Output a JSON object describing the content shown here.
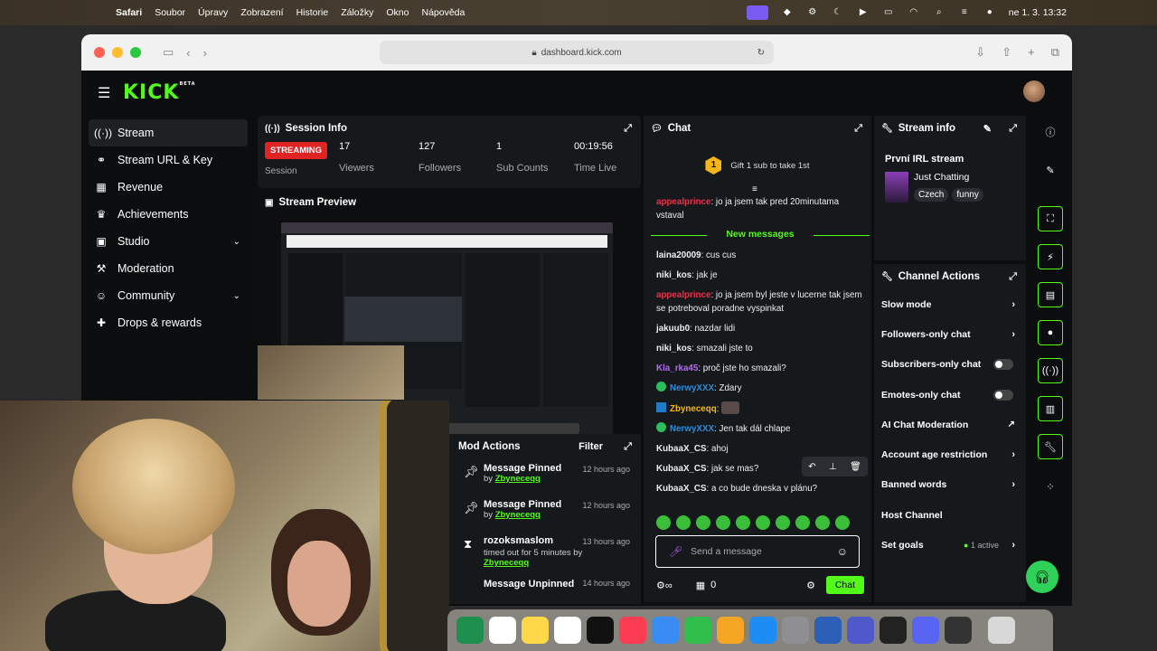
{
  "menubar": {
    "app": "Safari",
    "items": [
      "Soubor",
      "Úpravy",
      "Zobrazení",
      "Historie",
      "Záložky",
      "Okno",
      "Nápověda"
    ],
    "clock": "ne 1. 3.  13:32"
  },
  "browser": {
    "url": "dashboard.kick.com"
  },
  "brand": {
    "logo": "KICK",
    "beta": "BETA",
    "accent": "#53fc18"
  },
  "sidebar": {
    "items": [
      {
        "label": "Stream",
        "icon": "broadcast-icon"
      },
      {
        "label": "Stream URL & Key",
        "icon": "link-icon"
      },
      {
        "label": "Revenue",
        "icon": "revenue-icon"
      },
      {
        "label": "Achievements",
        "icon": "trophy-icon"
      },
      {
        "label": "Studio",
        "icon": "studio-icon"
      },
      {
        "label": "Moderation",
        "icon": "hammer-icon"
      },
      {
        "label": "Community",
        "icon": "community-icon"
      },
      {
        "label": "Drops & rewards",
        "icon": "gift-icon"
      }
    ]
  },
  "session": {
    "title": "Session Info",
    "status": "STREAMING",
    "status_sub": "Session",
    "stats": [
      {
        "value": "17",
        "label": "Viewers"
      },
      {
        "value": "127",
        "label": "Followers"
      },
      {
        "value": "1",
        "label": "Sub Counts"
      },
      {
        "value": "00:19:56",
        "label": "Time Live"
      }
    ]
  },
  "preview": {
    "title": "Stream Preview"
  },
  "mod_actions": {
    "title": "Mod Actions",
    "filter": "Filter",
    "rows": [
      {
        "title": "Message Pinned",
        "by_prefix": "by",
        "by": "Zbyneceqq",
        "time": "12 hours ago",
        "icon": "pin-icon"
      },
      {
        "title": "Message Pinned",
        "by_prefix": "by",
        "by": "Zbyneceqq",
        "time": "12 hours ago",
        "icon": "pin-icon"
      },
      {
        "title": "rozoksmaslom",
        "detail": "timed out for 5 minutes by",
        "by": "Zbyneceqq",
        "time": "13 hours ago",
        "icon": "hourglass-icon"
      },
      {
        "title": "Message Unpinned",
        "time": "14 hours ago",
        "icon": "pin-icon"
      }
    ]
  },
  "chat": {
    "title": "Chat",
    "gift": "Gift 1 sub to take 1st",
    "gift_rank": "1",
    "new_messages": "New messages",
    "messages": [
      {
        "user": "appealprince",
        "text": "jo ja jsem tak pred 20minutama vstaval",
        "color": "#e8334a"
      },
      {
        "user": "laina20009",
        "text": "cus cus",
        "color": "#ffffff"
      },
      {
        "user": "niki_kos",
        "text": "jak je",
        "color": "#ffffff"
      },
      {
        "user": "appealprince",
        "text": "jo ja jsem byl jeste v lucerne tak jsem se potreboval poradne vyspinkat",
        "color": "#e8334a"
      },
      {
        "user": "jakuub0",
        "text": "nazdar lidi",
        "color": "#ffffff"
      },
      {
        "user": "niki_kos",
        "text": "smazali jste to",
        "color": "#ffffff"
      },
      {
        "user": "Kla_rka45",
        "text": "proč jste ho smazali?",
        "color": "#b46bf0"
      },
      {
        "user": "NerwyXXX",
        "text": "Zdary",
        "color": "#2f8bd8",
        "badge": "check"
      },
      {
        "user": "Zbyneceqq",
        "text": "",
        "color": "#f6b618",
        "badge": "sword"
      },
      {
        "user": "NerwyXXX",
        "text": "Jen tak dál chlape",
        "color": "#2f8bd8",
        "badge": "check"
      },
      {
        "user": "KubaaX_CS",
        "text": "ahoj",
        "color": "#ffffff"
      },
      {
        "user": "KubaaX_CS",
        "text": "jak se mas?",
        "color": "#ffffff"
      },
      {
        "user": "KubaaX_CS",
        "text": "a co bude dneska v plánu?",
        "color": "#ffffff"
      }
    ],
    "input_placeholder": "Send a message",
    "count": "0",
    "send": "Chat"
  },
  "stream_info": {
    "title": "Stream info",
    "stream_title": "První IRL stream",
    "category": "Just Chatting",
    "tags": [
      "Czech",
      "funny"
    ]
  },
  "channel_actions": {
    "title": "Channel Actions",
    "rows": [
      {
        "label": "Slow mode",
        "control": "arrow"
      },
      {
        "label": "Followers-only chat",
        "control": "arrow"
      },
      {
        "label": "Subscribers-only chat",
        "control": "toggle"
      },
      {
        "label": "Emotes-only chat",
        "control": "toggle"
      },
      {
        "label": "AI Chat Moderation",
        "control": "external"
      },
      {
        "label": "Account age restriction",
        "control": "arrow"
      },
      {
        "label": "Banned words",
        "control": "arrow"
      },
      {
        "label": "Host Channel",
        "control": "none"
      },
      {
        "label": "Set goals",
        "control": "arrow",
        "status": "1 active"
      }
    ]
  }
}
